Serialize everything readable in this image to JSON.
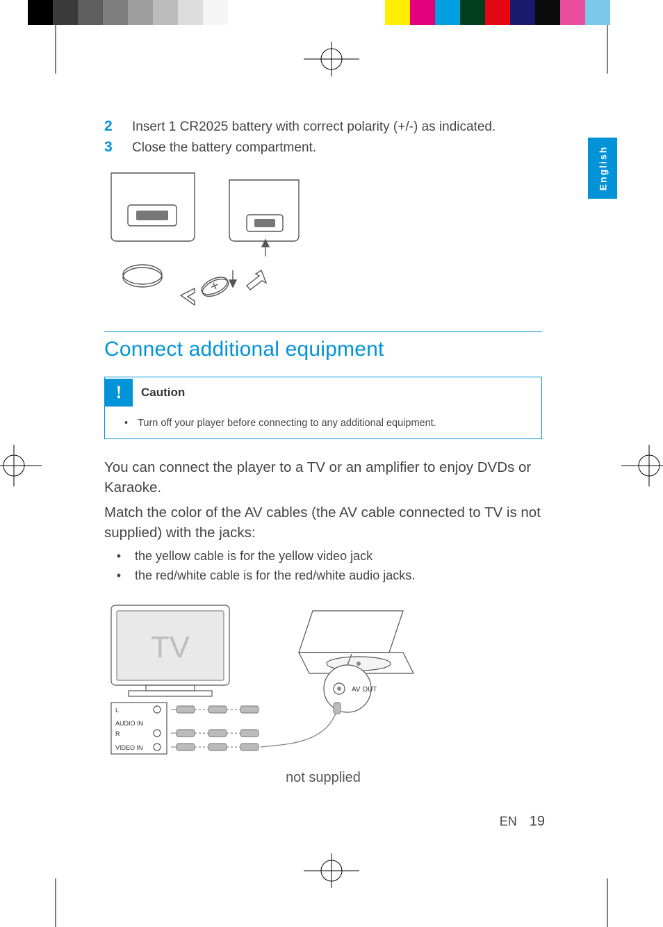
{
  "steps": [
    {
      "num": "2",
      "text": "Insert 1 CR2025 battery with correct polarity (+/-) as indicated."
    },
    {
      "num": "3",
      "text": "Close the battery compartment."
    }
  ],
  "section_title": "Connect additional equipment",
  "caution": {
    "label": "Caution",
    "text": "Turn off your player before connecting to any additional equipment."
  },
  "body": {
    "para1": "You can connect the player to a TV or an amplifier to enjoy DVDs or Karaoke.",
    "para2": "Match the color of the AV cables (the AV cable connected to TV is not supplied) with the jacks:",
    "bullets": [
      "the yellow cable is for the yellow video jack",
      "the red/white cable is for the red/white audio jacks."
    ]
  },
  "figure2": {
    "tv_label": "TV",
    "audio_in": "AUDIO IN",
    "audio_l": "L",
    "audio_r": "R",
    "video_in": "VIDEO IN",
    "av_out": "AV OUT",
    "caption": "not supplied"
  },
  "language_tab": "English",
  "footer": {
    "lang": "EN",
    "page": "19"
  },
  "accent": "#0093d7"
}
